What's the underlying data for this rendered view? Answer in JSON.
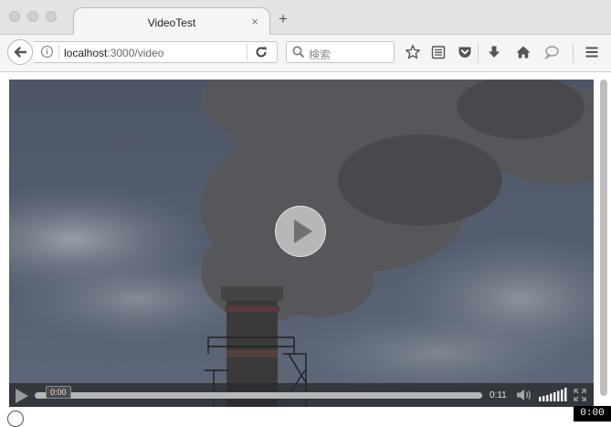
{
  "window": {
    "tab_title": "VideoTest",
    "tab_close": "×",
    "new_tab": "+"
  },
  "navbar": {
    "info_glyph": "i",
    "url_host": "localhost",
    "url_rest": ":3000/video",
    "search_placeholder": "検索",
    "icons": [
      "back-arrow-icon",
      "info-icon",
      "reload-icon",
      "search-icon",
      "bookmark-star-icon",
      "reader-list-icon",
      "pocket-icon",
      "download-arrow-icon",
      "home-icon",
      "chat-bubble-icon",
      "hamburger-menu-icon"
    ]
  },
  "video_player": {
    "current_time": "0:00",
    "duration": "0:11",
    "progress_fraction": 0.0,
    "volume_level": 1.0
  },
  "overlay": {
    "timer": "0:00"
  },
  "colors": {
    "sky": "#4f5a6b",
    "smoke": "#5a5a5e",
    "controls_bg": "#282a2e",
    "tab_bar": "#e3e3e3"
  }
}
